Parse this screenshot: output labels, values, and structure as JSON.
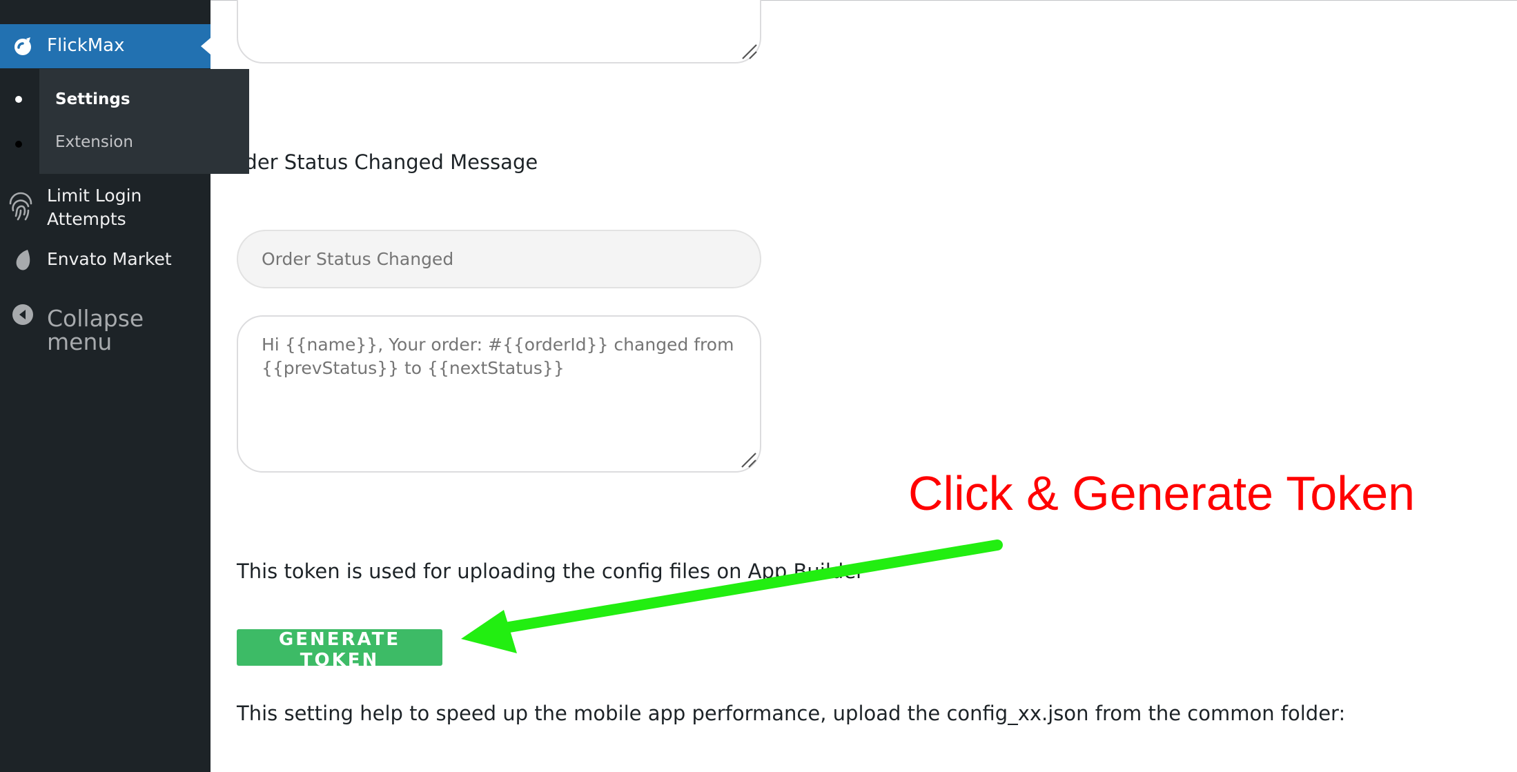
{
  "sidebar": {
    "active_item": {
      "label": "FlickMax",
      "icon": "flickmax-logo-icon"
    },
    "submenu": [
      {
        "label": "Settings",
        "current": true
      },
      {
        "label": "Extension",
        "current": false
      }
    ],
    "items": [
      {
        "label_line1": "Limit Login",
        "label_line2": "Attempts",
        "icon": "fingerprint-icon"
      },
      {
        "label": "Envato Market",
        "icon": "envato-leaf-icon"
      },
      {
        "label": "Collapse menu",
        "icon": "collapse-arrow-icon"
      }
    ]
  },
  "main": {
    "section_label": "rder Status Changed Message",
    "subject_field": {
      "placeholder": "Order Status Changed"
    },
    "message_field": {
      "placeholder": "Hi {{name}}, Your order: #{{orderId}} changed from {{prevStatus}} to {{nextStatus}}"
    },
    "token_description": "This token is used for uploading the config files on App Builder",
    "generate_button_label": "GENERATE TOKEN",
    "performance_description": "This setting help to speed up the mobile app performance, upload the config_xx.json from the common folder:"
  },
  "annotation": {
    "text": "Click & Generate Token",
    "color": "#ff0000",
    "arrow_color": "#22ee11"
  },
  "colors": {
    "sidebar_bg": "#1d2327",
    "active_menu_bg": "#2271b1",
    "button_green": "#3dbb66"
  }
}
